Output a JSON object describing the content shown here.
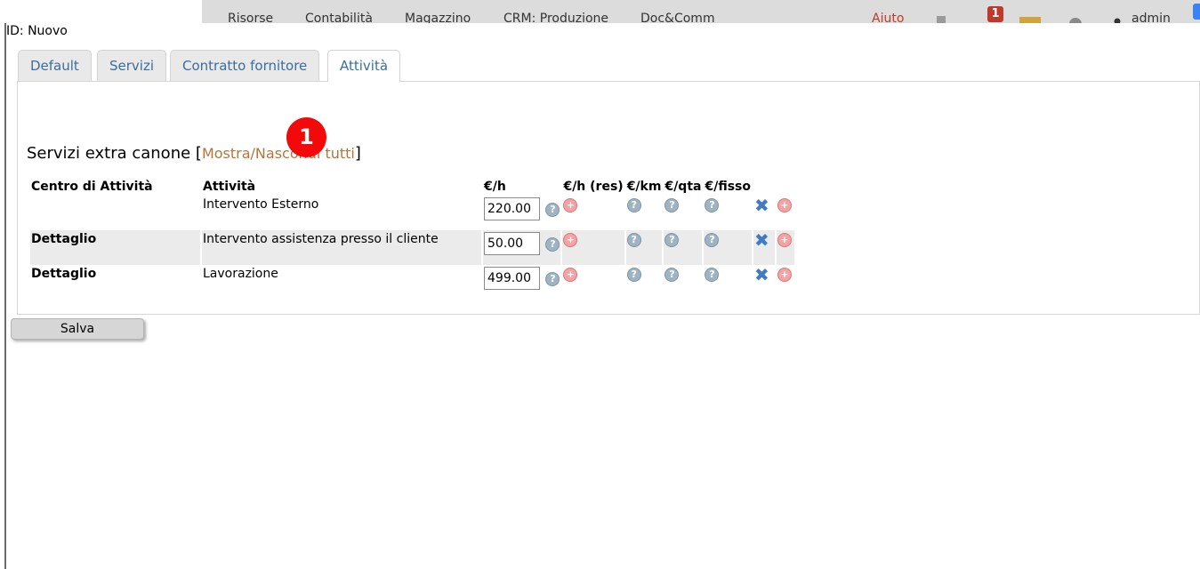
{
  "topbar": {
    "menu": [
      "Risorse",
      "Contabilità",
      "Magazzino",
      "CRM: Produzione",
      "Doc&Comm"
    ],
    "help_label": "Aiuto",
    "notifications_count": "1",
    "user_label": "admin"
  },
  "dialog": {
    "id_label": "ID: Nuovo",
    "tabs": [
      {
        "label": "Default"
      },
      {
        "label": "Servizi"
      },
      {
        "label": "Contratto fornitore"
      },
      {
        "label": "Attività"
      }
    ],
    "active_tab": "Attività",
    "section_title": "Servizi extra canone",
    "toggle_link": "Mostra/Nascondi tutti",
    "step_number": "1",
    "columns": {
      "centro": "Centro di Attività",
      "attivita": "Attività",
      "eur_h": "€/h",
      "eur_h_res": "€/h (res)",
      "eur_km": "€/km",
      "eur_qta": "€/qta",
      "eur_fisso": "€/fisso"
    },
    "rows": [
      {
        "centro": "",
        "attivita": "Intervento Esterno",
        "price": "220.00"
      },
      {
        "centro": "Dettaglio",
        "attivita": "Intervento assistenza presso il cliente",
        "price": "50.00"
      },
      {
        "centro": "Dettaglio",
        "attivita": "Lavorazione",
        "price": "499.00"
      }
    ],
    "save_label": "Salva"
  },
  "colors": {
    "tab_text": "#3a6e9e",
    "link": "#b8743a",
    "step_badge": "#f20a0a",
    "row_alt": "#ebebeb"
  },
  "icons": {
    "help": "question-circle-icon",
    "add": "plus-circle-icon",
    "delete": "x-icon"
  }
}
